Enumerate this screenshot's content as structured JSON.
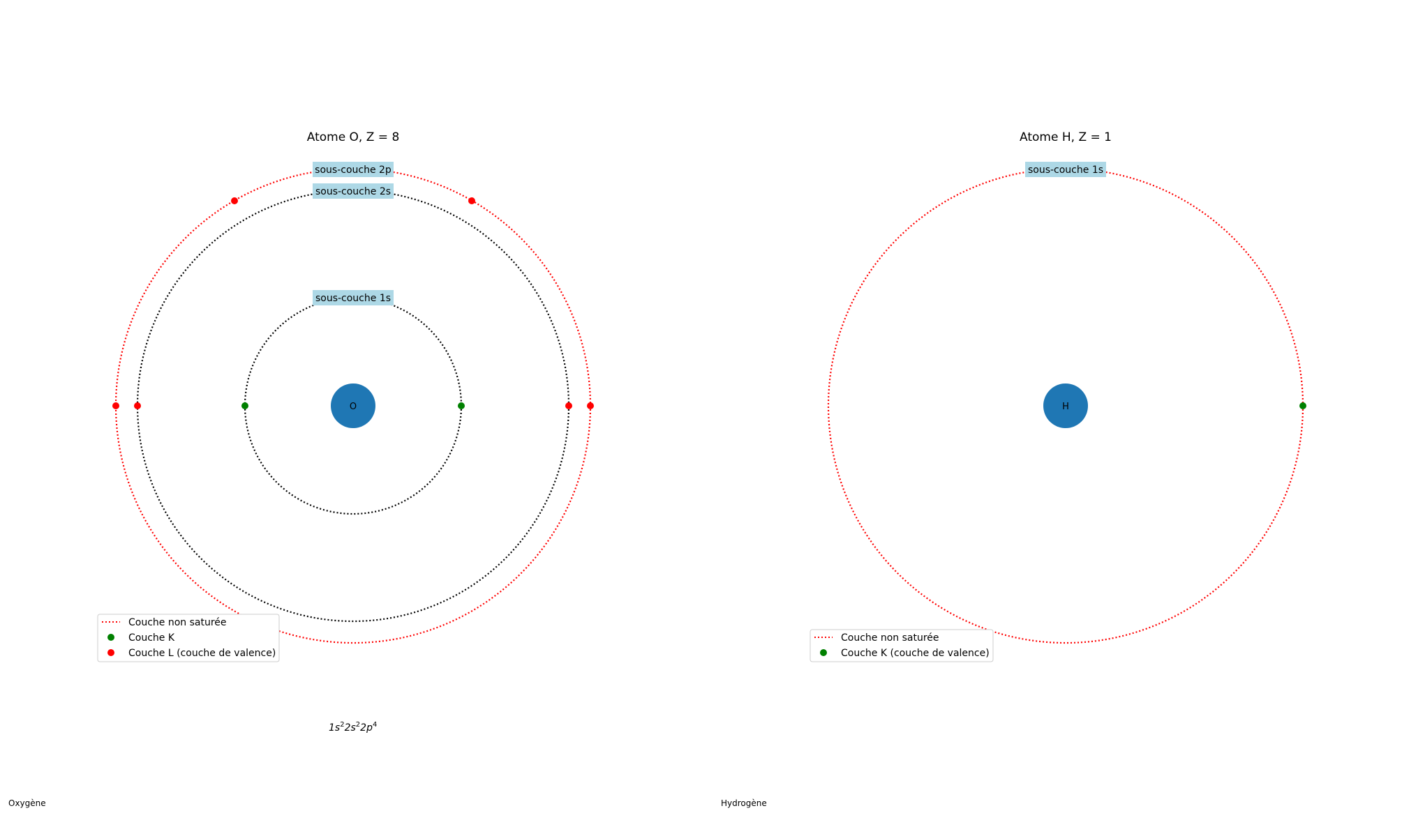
{
  "colors": {
    "nucleus": "#1f77b4",
    "saturated_shell": "#000000",
    "unsaturated_shell": "#ff0000",
    "electron_k": "#008000",
    "electron_l": "#ff0000",
    "subshell_label_bg": "#add8e6"
  },
  "panels": [
    {
      "title": "Atome O, Z = 8",
      "nucleus_label": "O",
      "footer": "Oxygène",
      "formula": {
        "parts": [
          {
            "base": "1s",
            "exp": "2"
          },
          {
            "base": "2s",
            "exp": "2"
          },
          {
            "base": "2p",
            "exp": "4"
          }
        ]
      },
      "shells": [
        {
          "name": "K",
          "label": "sous-couche 1s",
          "saturated": true,
          "relative_radius": 1,
          "electron_angles_deg": [
            0,
            180
          ]
        },
        {
          "name": "L-2s",
          "label": "sous-couche 2s",
          "saturated": true,
          "relative_radius": 2,
          "electron_angles_deg": [
            0,
            180
          ]
        },
        {
          "name": "L-2p",
          "label": "sous-couche 2p",
          "saturated": false,
          "relative_radius": 2.2,
          "electron_angles_deg": [
            0,
            60,
            120,
            180
          ]
        }
      ],
      "legend": [
        {
          "kind": "line",
          "label": "Couche non saturée"
        },
        {
          "kind": "dot-k",
          "label": "Couche K"
        },
        {
          "kind": "dot-l",
          "label": "Couche L (couche de valence)"
        }
      ]
    },
    {
      "title": "Atome H, Z = 1",
      "nucleus_label": "H",
      "footer": "Hydrogène",
      "shells": [
        {
          "name": "K",
          "label": "sous-couche 1s",
          "saturated": false,
          "relative_radius": 2.2,
          "electron_angles_deg": [
            0
          ]
        }
      ],
      "legend": [
        {
          "kind": "line",
          "label": "Couche non saturée"
        },
        {
          "kind": "dot-k",
          "label": "Couche K (couche de valence)"
        }
      ]
    }
  ]
}
